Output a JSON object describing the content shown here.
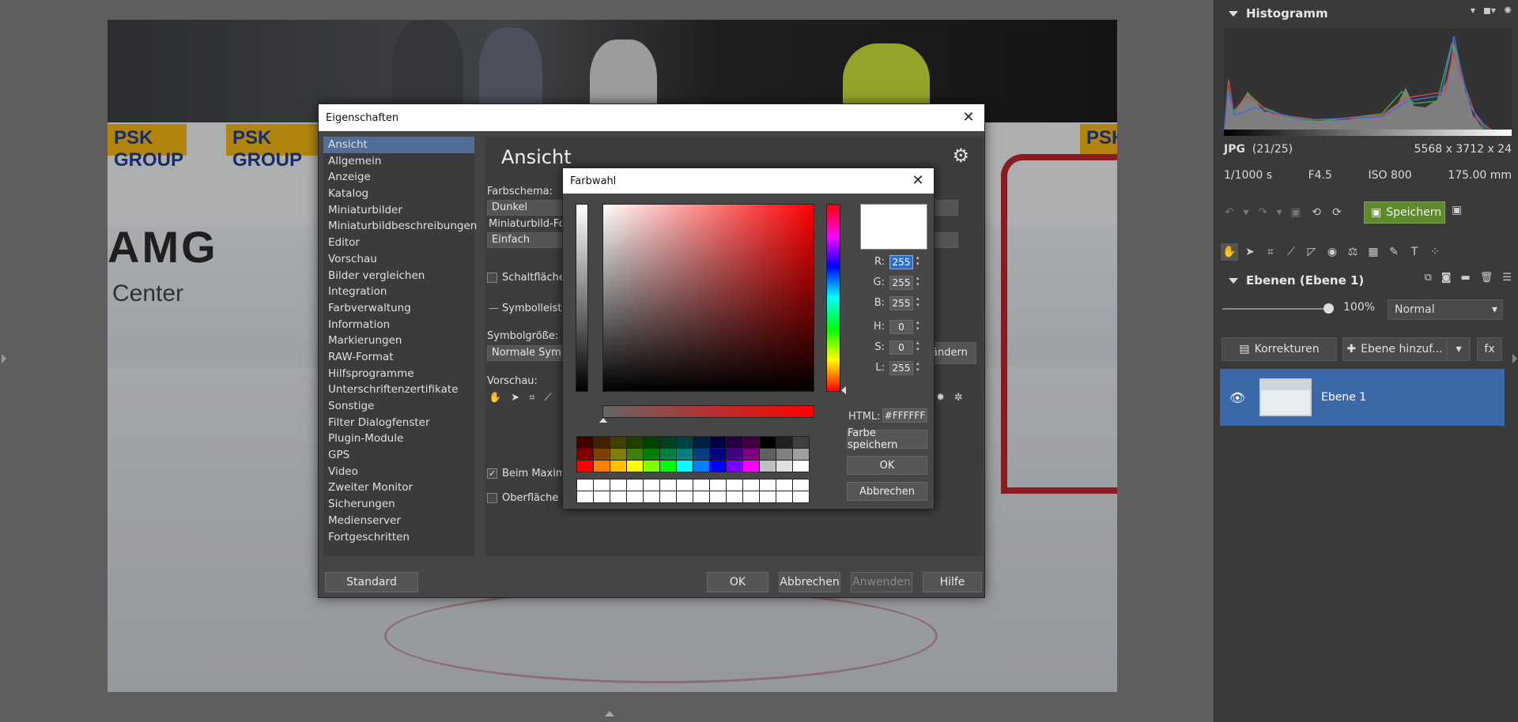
{
  "photo": {
    "ads": [
      "PSK GROUP",
      "PSK GROUP",
      "PSK"
    ],
    "brand": "AMG",
    "center_text": "Center"
  },
  "right_panel": {
    "histogram_title": "Histogramm",
    "file_type": "JPG",
    "file_index": "(21/25)",
    "dimensions": "5568 x 3712 x 24",
    "shutter": "1/1000 s",
    "aperture": "F4.5",
    "iso": "ISO 800",
    "focal": "175.00 mm",
    "save_label": "Speichern",
    "layers_title": "Ebenen (Ebene 1)",
    "opacity": "100%",
    "blend_mode": "Normal",
    "corrections_label": "Korrekturen",
    "add_layer_label": "Ebene hinzuf...",
    "fx_label": "fx",
    "layer_name": "Ebene 1",
    "colors": {
      "accent_green": "#5e8a2c",
      "layer_selected": "#3b69a8"
    }
  },
  "dialog": {
    "title": "Eigenschaften",
    "nav": [
      "Ansicht",
      "Allgemein",
      "Anzeige",
      "Katalog",
      "Miniaturbilder",
      "Miniaturbildbeschreibungen",
      "Editor",
      "Vorschau",
      "Bilder vergleichen",
      "Integration",
      "Farbverwaltung",
      "Information",
      "Markierungen",
      "RAW-Format",
      "Hilfsprogramme",
      "Unterschriftenzertifikate",
      "Sonstige",
      "Filter Dialogfenster",
      "Plugin-Module",
      "GPS",
      "Video",
      "Zweiter Monitor",
      "Sicherungen",
      "Medienserver",
      "Fortgeschritten"
    ],
    "section_title": "Ansicht",
    "farbschema_label": "Farbschema:",
    "farbschema_value": "Dunkel",
    "miniatur_label": "Miniaturbild-Fo",
    "miniatur_value": "Einfach",
    "schaltflaechen_label": "Schaltfläche",
    "symbolleiste_label": "Symbolleiste",
    "symbolgroesse_label": "Symbolgröße:",
    "symbolgroesse_value": "Normale Symb",
    "aendern_label": "ändern",
    "vorschau_label": "Vorschau:",
    "beim_max_label": "Beim Maxim",
    "touch_label": "Oberfläche für Touchgeräte optimieren",
    "btn_standard": "Standard",
    "btn_ok": "OK",
    "btn_cancel": "Abbrechen",
    "btn_apply": "Anwenden",
    "btn_help": "Hilfe"
  },
  "colorpicker": {
    "title": "Farbwahl",
    "r": "255",
    "g": "255",
    "b": "255",
    "h": "0",
    "s": "0",
    "l": "255",
    "labels": {
      "r": "R:",
      "g": "G:",
      "b": "B:",
      "h": "H:",
      "s": "S:",
      "l": "L:",
      "html": "HTML:"
    },
    "html_value": "#FFFFFF",
    "btn_save_color": "Farbe speichern",
    "btn_ok": "OK",
    "btn_cancel": "Abbrechen",
    "current_color": "#FFFFFF",
    "swatches_row1": [
      "#400000",
      "#402000",
      "#404000",
      "#204000",
      "#004000",
      "#004020",
      "#004040",
      "#002040",
      "#000040",
      "#200040",
      "#400040",
      "#000000",
      "#202020",
      "#404040"
    ],
    "swatches_row2": [
      "#800000",
      "#804000",
      "#808000",
      "#408000",
      "#008000",
      "#008040",
      "#008080",
      "#004080",
      "#000080",
      "#400080",
      "#800080",
      "#606060",
      "#808080",
      "#a0a0a0"
    ],
    "swatches_row3": [
      "#ff0000",
      "#ff8000",
      "#ffc000",
      "#ffff00",
      "#80ff00",
      "#00ff00",
      "#00ffff",
      "#0080ff",
      "#0000ff",
      "#8000ff",
      "#ff00ff",
      "#c0c0c0",
      "#e0e0e0",
      "#ffffff"
    ]
  }
}
